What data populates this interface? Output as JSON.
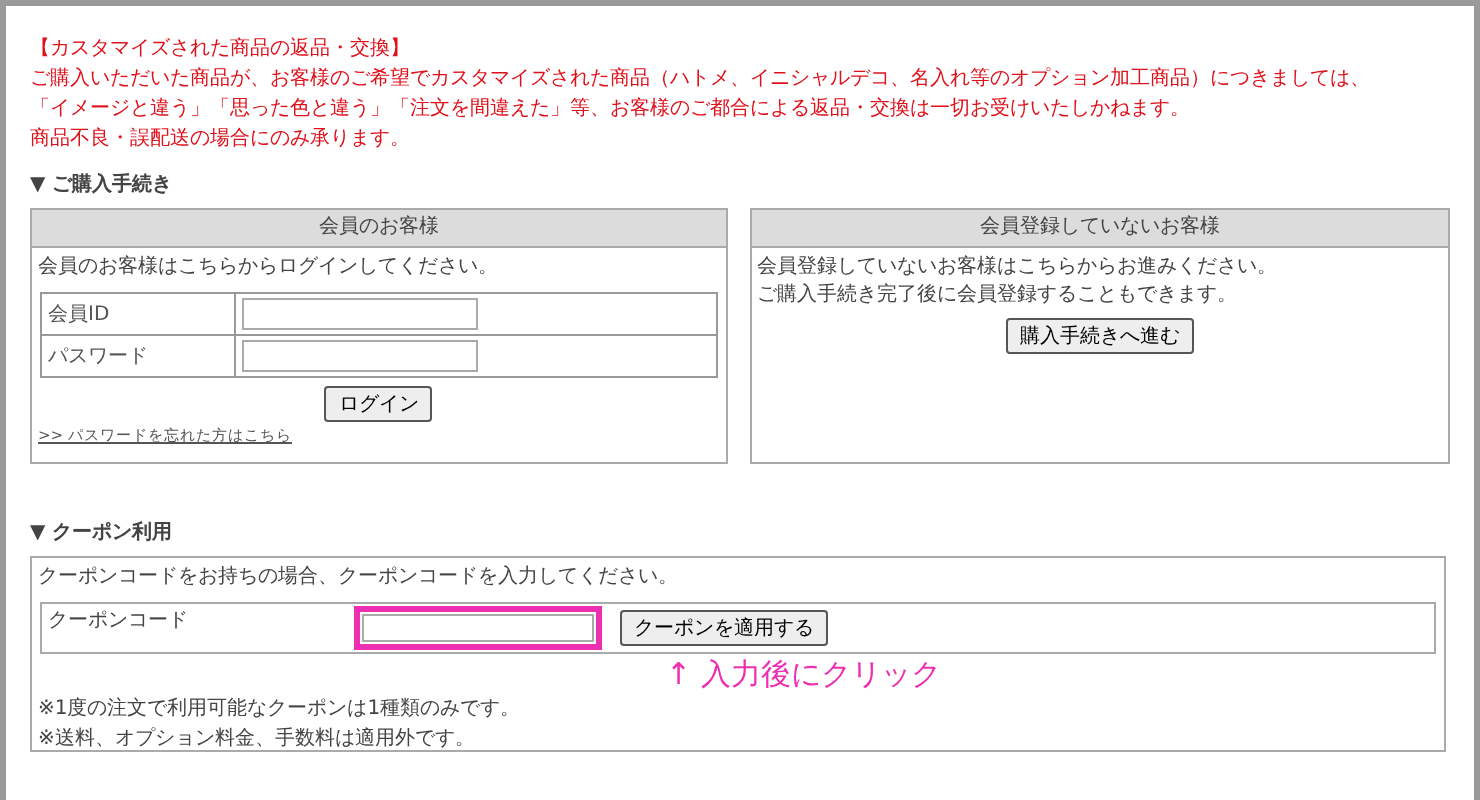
{
  "notice": {
    "title": "【カスタマイズされた商品の返品・交換】",
    "lines": [
      "ご購入いただいた商品が、お客様のご希望でカスタマイズされた商品（ハトメ、イニシャルデコ、名入れ等のオプション加工商品）につきましては、",
      "「イメージと違う」「思った色と違う」「注文を間違えた」等、お客様のご都合による返品・交換は一切お受けいたしかねます。",
      "商品不良・誤配送の場合にのみ承ります。"
    ]
  },
  "purchase": {
    "heading": "▼ ご購入手続き",
    "member": {
      "title": "会員のお客様",
      "intro": "会員のお客様はこちらからログインしてください。",
      "fields": [
        {
          "label": "会員ID"
        },
        {
          "label": "パスワード"
        }
      ],
      "button": "ログイン",
      "link": ">> パスワードを忘れた方はこちら"
    },
    "guest": {
      "title": "会員登録していないお客様",
      "lines": [
        "会員登録していないお客様はこちらからお進みください。",
        "ご購入手続き完了後に会員登録することもできます。"
      ],
      "button": "購入手続きへ進む"
    }
  },
  "coupon": {
    "heading": "▼ クーポン利用",
    "intro": "クーポンコードをお持ちの場合、クーポンコードを入力してください。",
    "label": "クーポンコード",
    "button": "クーポンを適用する",
    "highlighted": true,
    "annotation": "↑ 入力後にクリック",
    "notes": [
      "※1度の注文で利用可能なクーポンは1種類のみです。",
      "※送料、オプション料金、手数料は適用外です。"
    ]
  }
}
